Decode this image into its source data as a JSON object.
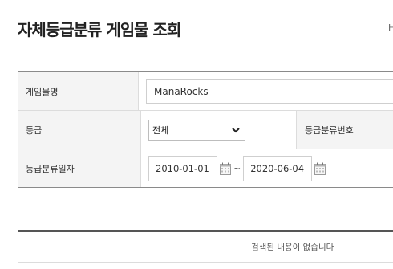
{
  "header": {
    "title": "자체등급분류 게임물 조회",
    "home_crumb": "H"
  },
  "form": {
    "game_name_label": "게임물명",
    "game_name_value": "ManaRocks",
    "rating_label": "등급",
    "rating_selected": "전체",
    "rating_number_label": "등급분류번호",
    "date_label": "등급분류일자",
    "date_from": "2010-01-01",
    "date_to": "2020-06-04",
    "date_separator": "~"
  },
  "results": {
    "empty_message": "검색된 내용이 없습니다"
  }
}
